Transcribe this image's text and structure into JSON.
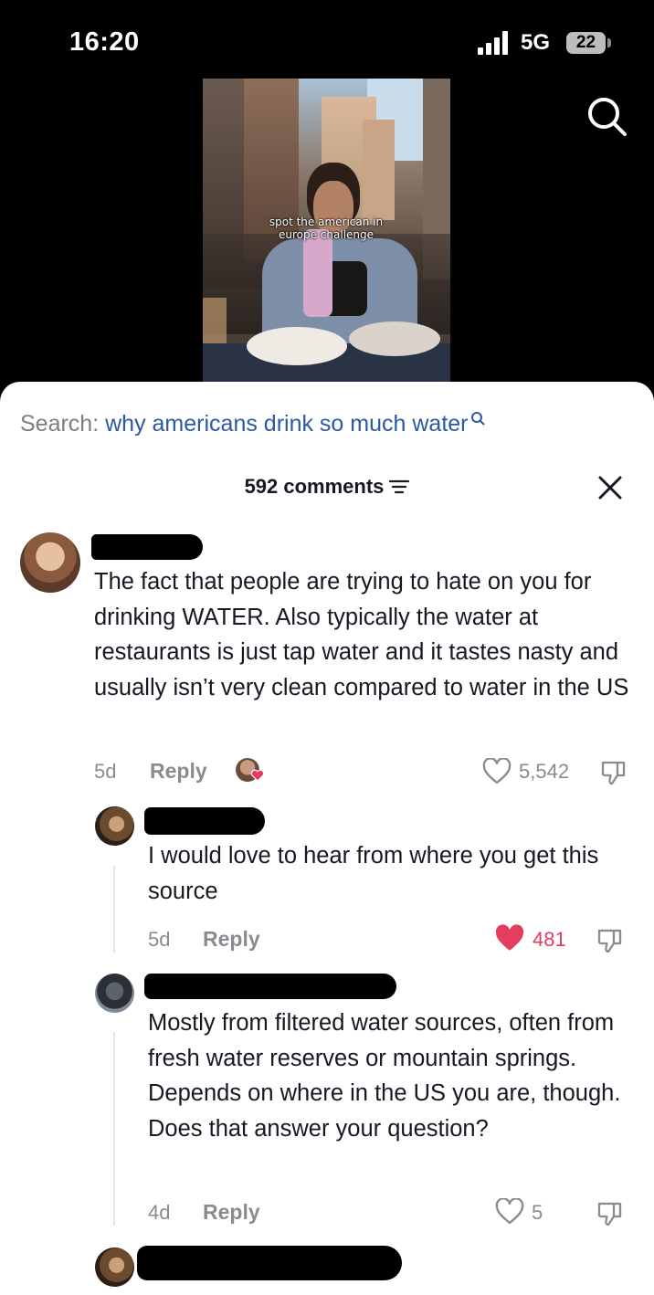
{
  "status": {
    "time": "16:20",
    "network": "5G",
    "battery": "22"
  },
  "video": {
    "caption": "spot the american in europe challenge"
  },
  "search": {
    "prefix": "Search:",
    "query": "why americans drink so much water"
  },
  "comments_header": {
    "count_label": "592 comments"
  },
  "comments": [
    {
      "text": "The fact that people are trying to hate on you for drinking WATER. Also typically the water at restaurants is just tap water and it tastes nasty and usually isn’t very clean compared to water in the US",
      "age": "5d",
      "reply_label": "Reply",
      "likes": "5,542",
      "liked": false
    },
    {
      "text": "I would love to hear from where you get this source",
      "age": "5d",
      "reply_label": "Reply",
      "likes": "481",
      "liked": true
    },
    {
      "text": "Mostly from filtered water sources, often from fresh water reserves or mountain springs. Depends on where in the US you are, though. Does that answer your question?",
      "age": "4d",
      "reply_label": "Reply",
      "likes": "5",
      "liked": false
    }
  ],
  "colors": {
    "accent_like": "#e43d5e",
    "search_link": "#2c58a5"
  }
}
